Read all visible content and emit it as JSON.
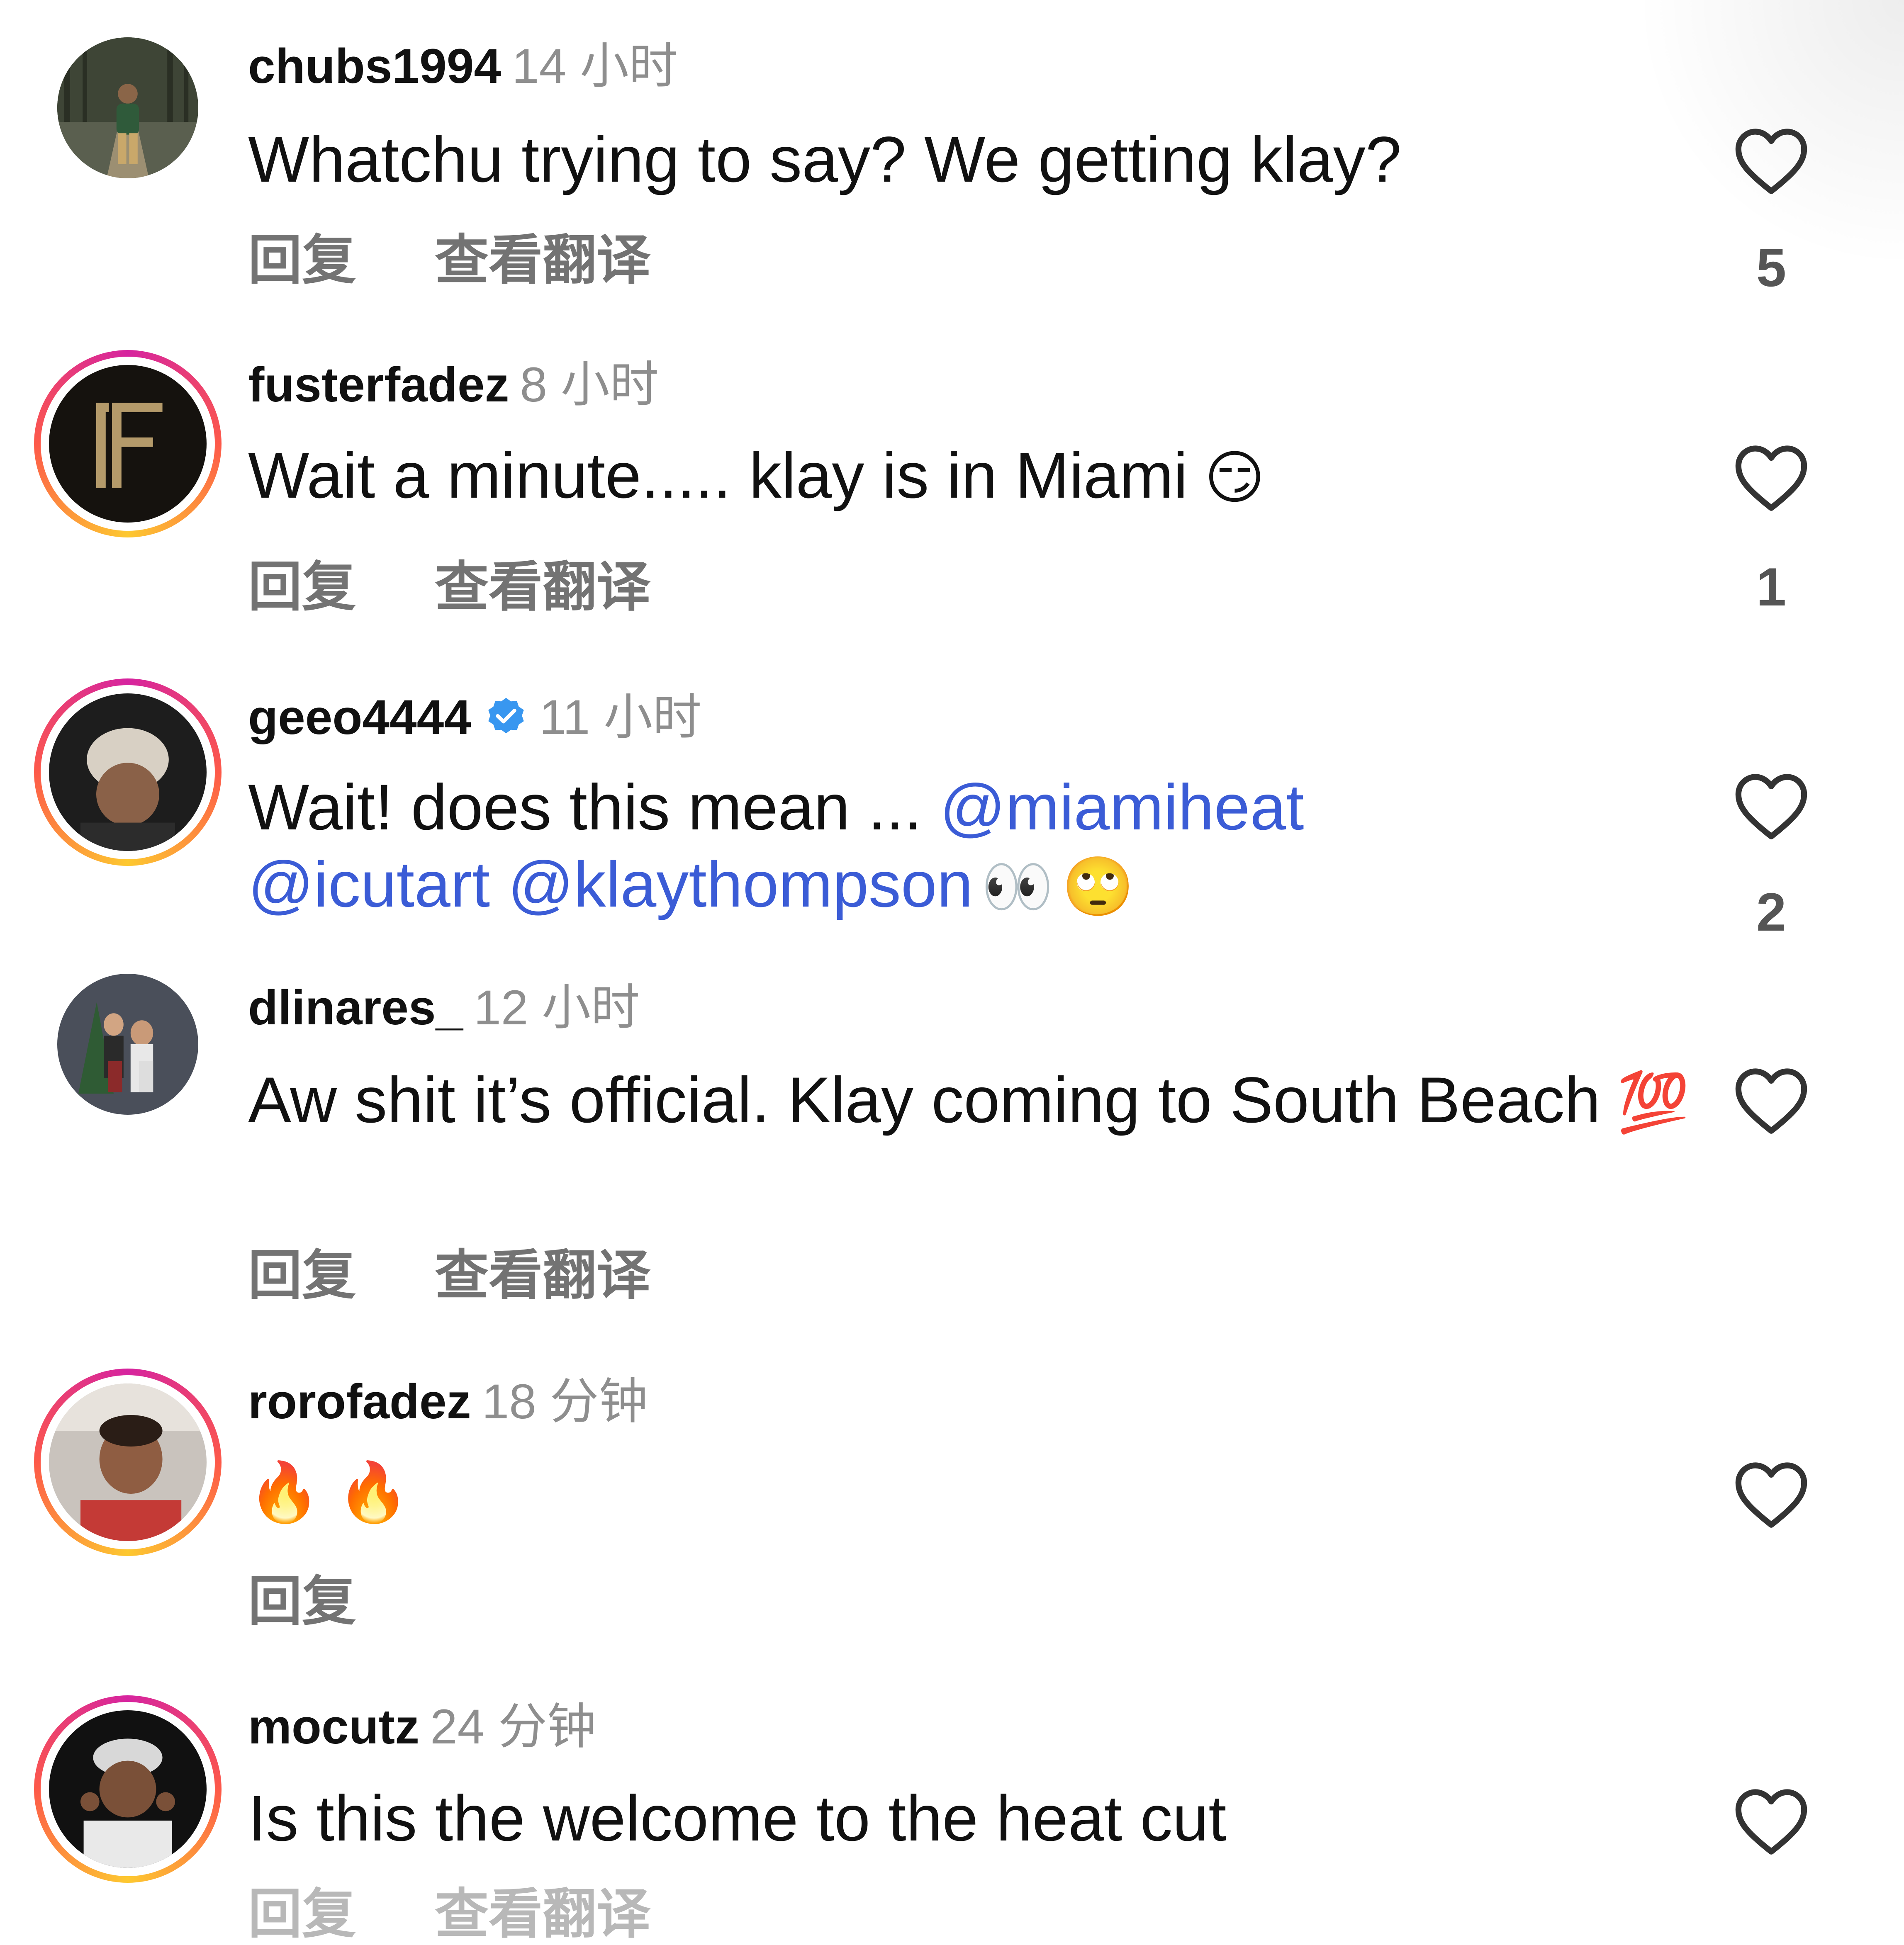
{
  "comments": [
    {
      "username": "chubs1994",
      "time": "14 小时",
      "text": "Whatchu trying to say? We getting klay?",
      "actions": [
        "回复",
        "查看翻译"
      ],
      "likes": "5"
    },
    {
      "username": "fusterfadez",
      "time": "8 小时",
      "text": "Wait a minute..... klay is in Miami",
      "emoji": "😏",
      "actions": [
        "回复",
        "查看翻译"
      ],
      "likes": "1"
    },
    {
      "username": "geeo4444",
      "time": "11 小时",
      "text": "Wait! does this mean ...",
      "mentions": [
        "@miamiheat",
        "@icutart",
        "@klaythompson"
      ],
      "emoji": [
        "👀",
        "🙄"
      ],
      "actions": [
        "回复",
        "查看翻译"
      ],
      "likes": "2"
    },
    {
      "username": "dlinares_",
      "time": "12 小时",
      "text": "Aw shit it’s official. Klay coming to South Beach",
      "emoji": "💯",
      "actions": [
        "回复",
        "查看翻译"
      ],
      "likes": ""
    },
    {
      "username": "rorofadez",
      "time": "18 分钟",
      "text": "",
      "emoji": [
        "🔥",
        "🔥"
      ],
      "actions": [
        "回复"
      ],
      "likes": ""
    },
    {
      "username": "mocutz",
      "time": "24 分钟",
      "text": "Is this the welcome to the heat cut",
      "actions": [
        "回复",
        "查看翻译"
      ],
      "likes": ""
    }
  ],
  "colors": {
    "mention": "#3b5cd6",
    "verified_badge": "#3897f0",
    "story_ring": [
      "#d6249f",
      "#fd5949",
      "#fdc830"
    ],
    "time_text": "#8e8e8e"
  },
  "icons": [
    "heart-outline-icon",
    "verified-badge-icon"
  ]
}
